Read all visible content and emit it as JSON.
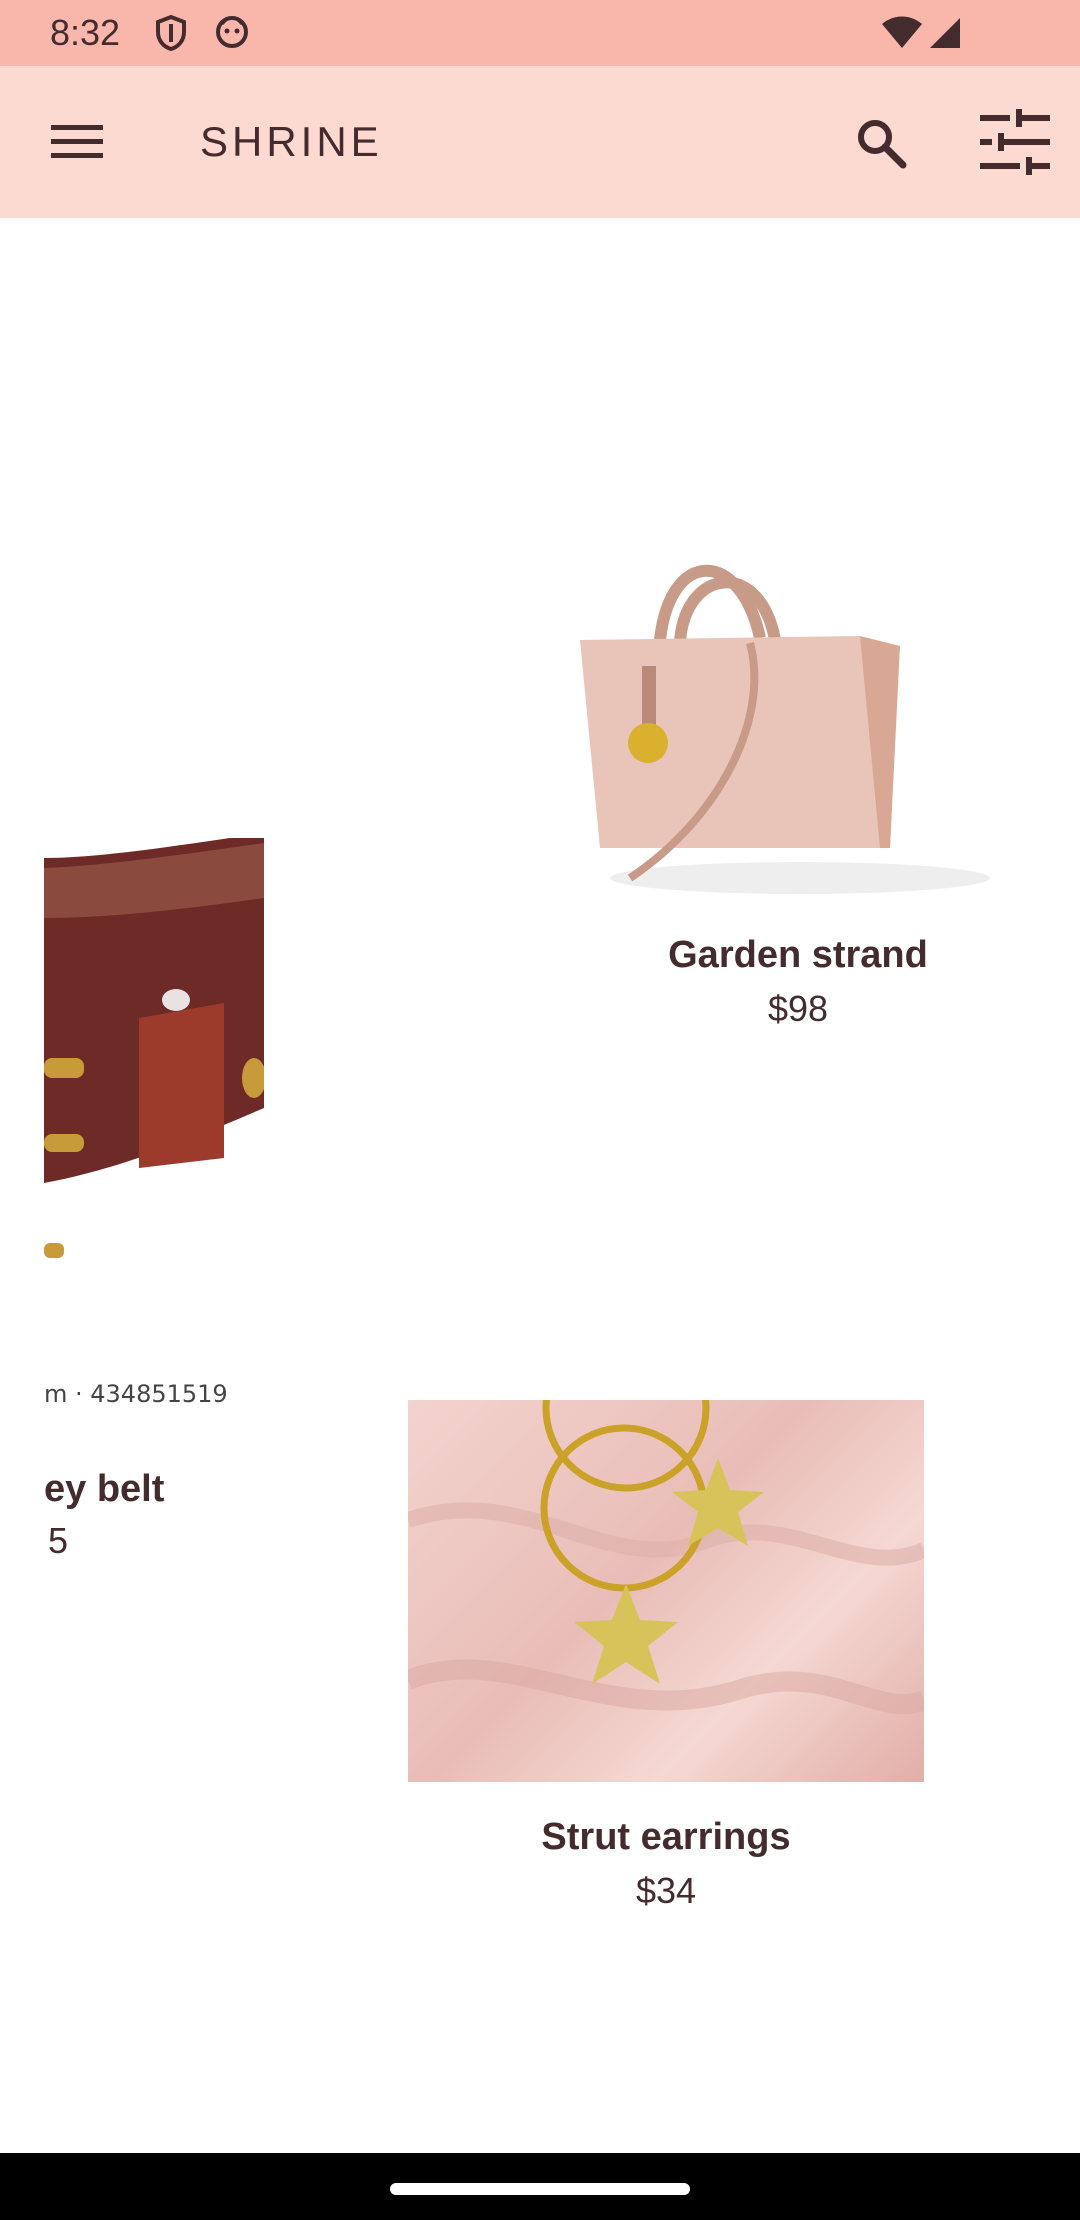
{
  "status_bar": {
    "time": "8:32",
    "icons": [
      "shield-icon",
      "face-icon",
      "wifi-icon",
      "signal-icon"
    ]
  },
  "top_bar": {
    "title": "SHRINE",
    "menu_icon": "menu-icon",
    "search_icon": "search-icon",
    "filter_icon": "tune-icon"
  },
  "products": [
    {
      "name": "ey belt",
      "price": "5",
      "caption": "m · 434851519"
    },
    {
      "name": "Garden strand",
      "price": "$98"
    },
    {
      "name": "Strut earrings",
      "price": "$34"
    }
  ],
  "colors": {
    "status_bar_bg": "#f9b7ac",
    "app_bar_bg": "#fcd9d1",
    "text": "#442c2e"
  }
}
